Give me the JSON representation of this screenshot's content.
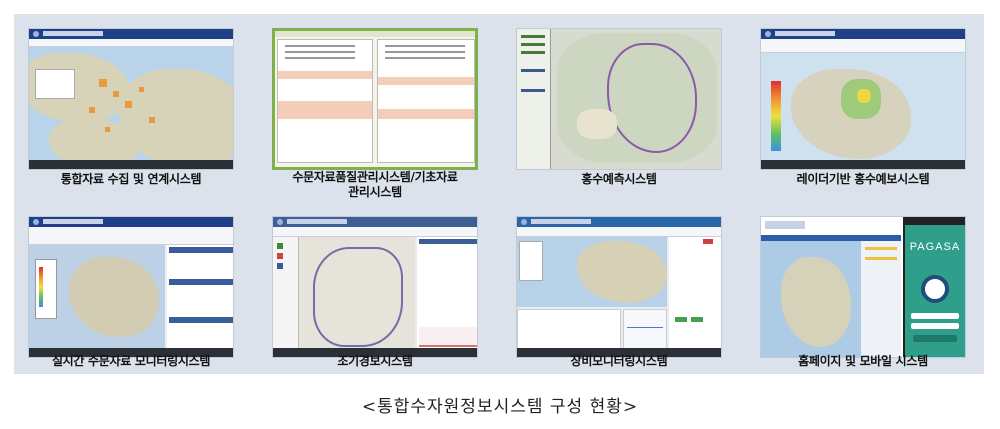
{
  "tiles": [
    {
      "label": "통합자료 수집 및 연계시스템"
    },
    {
      "label": "수문자료품질관리시스템/기초자료\n관리시스템"
    },
    {
      "label": "홍수예측시스템"
    },
    {
      "label": "레이더기반 홍수예보시스템"
    },
    {
      "label": "실시간 수문자료 모니터링시스템"
    },
    {
      "label": "조기경보시스템"
    },
    {
      "label": "장비모니터링시스템"
    },
    {
      "label": "홈페이지 및 모바일 시스템"
    }
  ],
  "mobile_brand": "PAGASA",
  "caption": "<통합수자원정보시스템 구성 현황>",
  "colors": {
    "panel_bg": "#dbe2ec",
    "app_header": "#1f3f86",
    "water": "#b9d3ea",
    "pagasa_green": "#2f9e8a"
  }
}
